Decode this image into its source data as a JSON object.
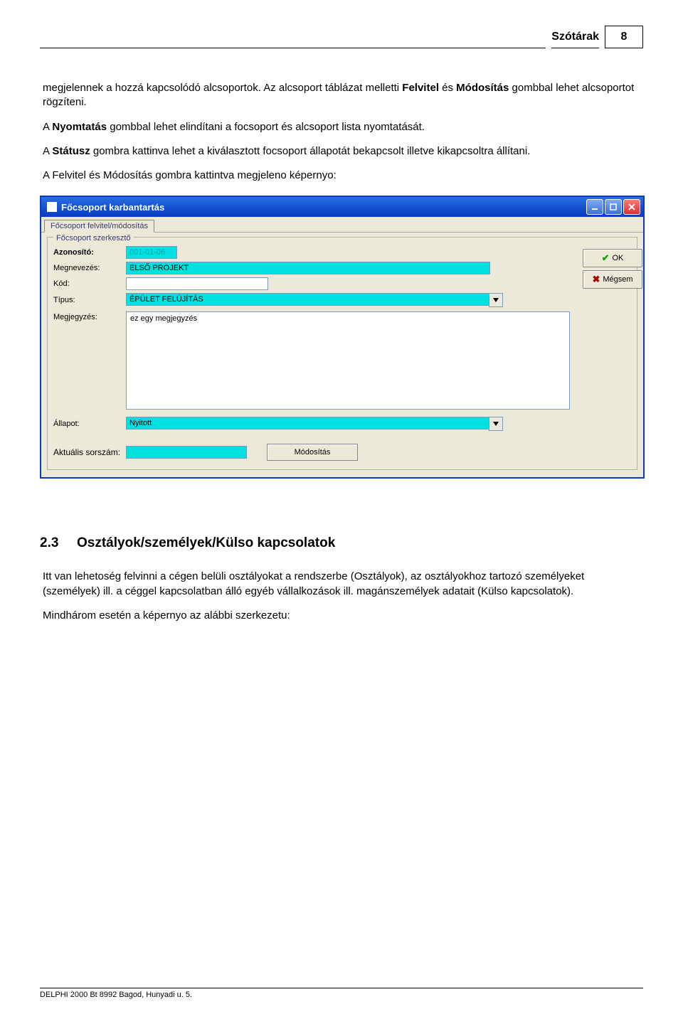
{
  "header": {
    "title": "Szótárak",
    "page": "8"
  },
  "para1_a": "megjelennek a hozzá kapcsolódó alcsoportok. Az alcsoport táblázat melletti ",
  "para1_b": "Felvitel",
  "para1_c": " és ",
  "para1_d": "Módosítás",
  "para1_e": " gombbal lehet alcsoportot rögzíteni.",
  "para2_a": "A ",
  "para2_b": "Nyomtatás",
  "para2_c": " gombbal lehet elindítani a focsoport és alcsoport lista nyomtatását.",
  "para3_a": "A ",
  "para3_b": "Státusz",
  "para3_c": " gombra kattinva lehet a kiválasztott focsoport állapotát bekapcsolt illetve kikapcsoltra állítani.",
  "para4": "A Felvitel és Módosítás gombra kattintva megjeleno képernyo:",
  "window": {
    "title": "Főcsoport karbantartás",
    "tab": "Főcsoport felvitel/módosítás",
    "panel_title": "Főcsoport szerkesztő",
    "labels": {
      "azonosito": "Azonosító:",
      "megnevezes": "Megnevezés:",
      "kod": "Kód:",
      "tipus": "Típus:",
      "megjegyzes": "Megjegyzés:",
      "allapot": "Állapot:",
      "aktualis": "Aktuális sorszám:"
    },
    "values": {
      "azonosito": "001-01-06",
      "megnevezes": "ELSŐ PROJEKT",
      "kod": "",
      "tipus": "ÉPÜLET FELÚJÍTÁS",
      "megjegyzes": "ez egy megjegyzés",
      "allapot": "Nyitott",
      "aktualis": ""
    },
    "buttons": {
      "ok": "OK",
      "cancel": "Mégsem",
      "modify": "Módosítás"
    }
  },
  "section": {
    "num": "2.3",
    "title": "Osztályok/személyek/Külso kapcsolatok",
    "p1": "Itt van lehetoség felvinni a cégen belüli osztályokat a rendszerbe (Osztályok), az osztályokhoz tartozó személyeket (személyek) ill. a céggel kapcsolatban álló egyéb vállalkozások ill. magánszemélyek adatait (Külso kapcsolatok).",
    "p2": "Mindhárom esetén a képernyo az alábbi szerkezetu:"
  },
  "footer": "DELPHI 2000 Bt 8992 Bagod, Hunyadi u. 5."
}
